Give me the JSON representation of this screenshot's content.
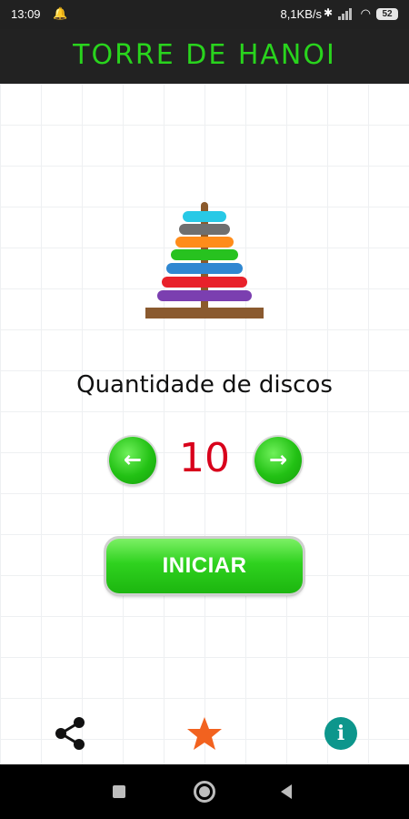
{
  "status_bar": {
    "time": "13:09",
    "network_speed": "8,1KB/s",
    "battery": "52"
  },
  "header": {
    "title": "TORRE DE HANOI",
    "title_color": "#29d41d"
  },
  "illustration": {
    "disk_colors": [
      "#28c9e6",
      "#6f6f6f",
      "#ff8c1a",
      "#27c21f",
      "#2f87d1",
      "#e8212a",
      "#7b3fb0"
    ]
  },
  "disk_selector": {
    "label": "Quantidade de discos",
    "value": "10",
    "prev_icon": "←",
    "next_icon": "→"
  },
  "start_button": {
    "label": "INICIAR"
  },
  "footer": {
    "share_icon": "share-icon",
    "star_icon": "star-icon",
    "info_icon": "i"
  }
}
